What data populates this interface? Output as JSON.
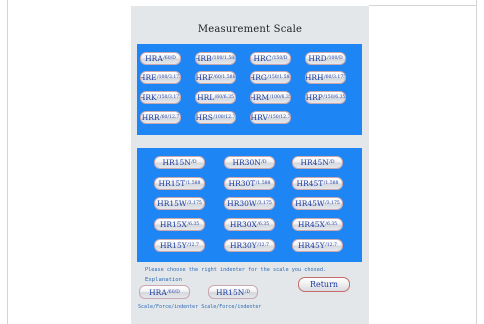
{
  "title": "Measurement Scale",
  "group1": [
    {
      "main": "HRA",
      "sub": "/60/D"
    },
    {
      "main": "HRB",
      "sub": "/100/1.588"
    },
    {
      "main": "HRC",
      "sub": "/150/D"
    },
    {
      "main": "HRD",
      "sub": "/100/D"
    },
    {
      "main": "HRE",
      "sub": "/100/3.175"
    },
    {
      "main": "HRF",
      "sub": "/60/1.588"
    },
    {
      "main": "HRG",
      "sub": "/150/1.588"
    },
    {
      "main": "HRH",
      "sub": "/60/3.175"
    },
    {
      "main": "HRK",
      "sub": "/150/3.175"
    },
    {
      "main": "HRL",
      "sub": "/60/6.35"
    },
    {
      "main": "HRM",
      "sub": "/100/6.35"
    },
    {
      "main": "HRP",
      "sub": "/150/6.35"
    },
    {
      "main": "HRR",
      "sub": "/60/12.7"
    },
    {
      "main": "HRS",
      "sub": "/100/12.7"
    },
    {
      "main": "HRV",
      "sub": "/150/12.7"
    }
  ],
  "group2": [
    {
      "main": "HR15N",
      "sub": "/D"
    },
    {
      "main": "HR30N",
      "sub": "/D"
    },
    {
      "main": "HR45N",
      "sub": "/D"
    },
    {
      "main": "HR15T",
      "sub": "/1.588"
    },
    {
      "main": "HR30T",
      "sub": "/1.588"
    },
    {
      "main": "HR45T",
      "sub": "/1.588"
    },
    {
      "main": "HR15W",
      "sub": "/3.175"
    },
    {
      "main": "HR30W",
      "sub": "/3.175"
    },
    {
      "main": "HR45W",
      "sub": "/3.175"
    },
    {
      "main": "HR15X",
      "sub": "/6.35"
    },
    {
      "main": "HR30X",
      "sub": "/6.35"
    },
    {
      "main": "HR45X",
      "sub": "/6.35"
    },
    {
      "main": "HR15Y",
      "sub": "/12.7"
    },
    {
      "main": "HR30Y",
      "sub": "/12.7"
    },
    {
      "main": "HR45Y",
      "sub": "/12.7"
    }
  ],
  "footer": {
    "note": "Please choose the right indenter for the scale you chosed.",
    "explanation_label": "Explanation",
    "example1": {
      "main": "HRA",
      "sub": "/60/D"
    },
    "example2": {
      "main": "HR15N",
      "sub": "/D"
    },
    "caption": "Scale/Force/indenter Scale/Force/indenter",
    "return_label": "Return"
  }
}
